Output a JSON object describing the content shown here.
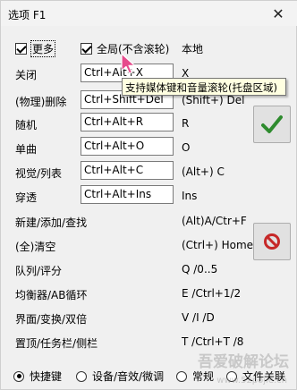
{
  "window": {
    "title": "选项 F1",
    "close_glyph": "✕"
  },
  "top_options": {
    "more_label": "更多",
    "global_label": "全局(不含滚轮)",
    "local_label": "本地"
  },
  "tooltip": "支持媒体键和音量滚轮(托盘区域)",
  "rows": [
    {
      "label": "关闭",
      "field": "Ctrl+Alt+X",
      "value": "X"
    },
    {
      "label": "(物理)删除",
      "field": "Ctrl+Shift+Del",
      "value": "(Shift+) Del"
    },
    {
      "label": "随机",
      "field": "Ctrl+Alt+R",
      "value": "R"
    },
    {
      "label": "单曲",
      "field": "Ctrl+Alt+O",
      "value": "O"
    },
    {
      "label": "视觉/列表",
      "field": "Ctrl+Alt+C",
      "value": "(Alt+) C"
    },
    {
      "label": "穿透",
      "field": "Ctrl+Alt+Ins",
      "value": "Ins"
    }
  ],
  "static_rows": [
    {
      "label": "新建/添加/查找",
      "value": "(Alt)A/Ctr+F"
    },
    {
      "label": "(全)清空",
      "value": "(Ctrl+) Home"
    },
    {
      "label": "队列/评分",
      "value": "Q /0..5"
    },
    {
      "label": "均衡器/AB循环",
      "value": "E /Ctrl+1/2"
    },
    {
      "label": "界面/变换/双倍",
      "value": "V /I /D"
    },
    {
      "label": "置顶/任务栏/侧栏",
      "value": "T /Ctrl+T /8"
    }
  ],
  "radios": [
    {
      "label": "快捷键",
      "selected": true
    },
    {
      "label": "设备/音效/微调",
      "selected": false
    },
    {
      "label": "常规",
      "selected": false
    },
    {
      "label": "文件关联",
      "selected": false
    }
  ],
  "buttons": {
    "ok_icon": "checkmark-icon",
    "cancel_icon": "no-entry-icon"
  },
  "colors": {
    "ok_green": "#2e8b2e",
    "cancel_red": "#c62828"
  },
  "watermark": {
    "text": "吾爱破解论坛",
    "url_text": "www.52pojie.cn"
  }
}
